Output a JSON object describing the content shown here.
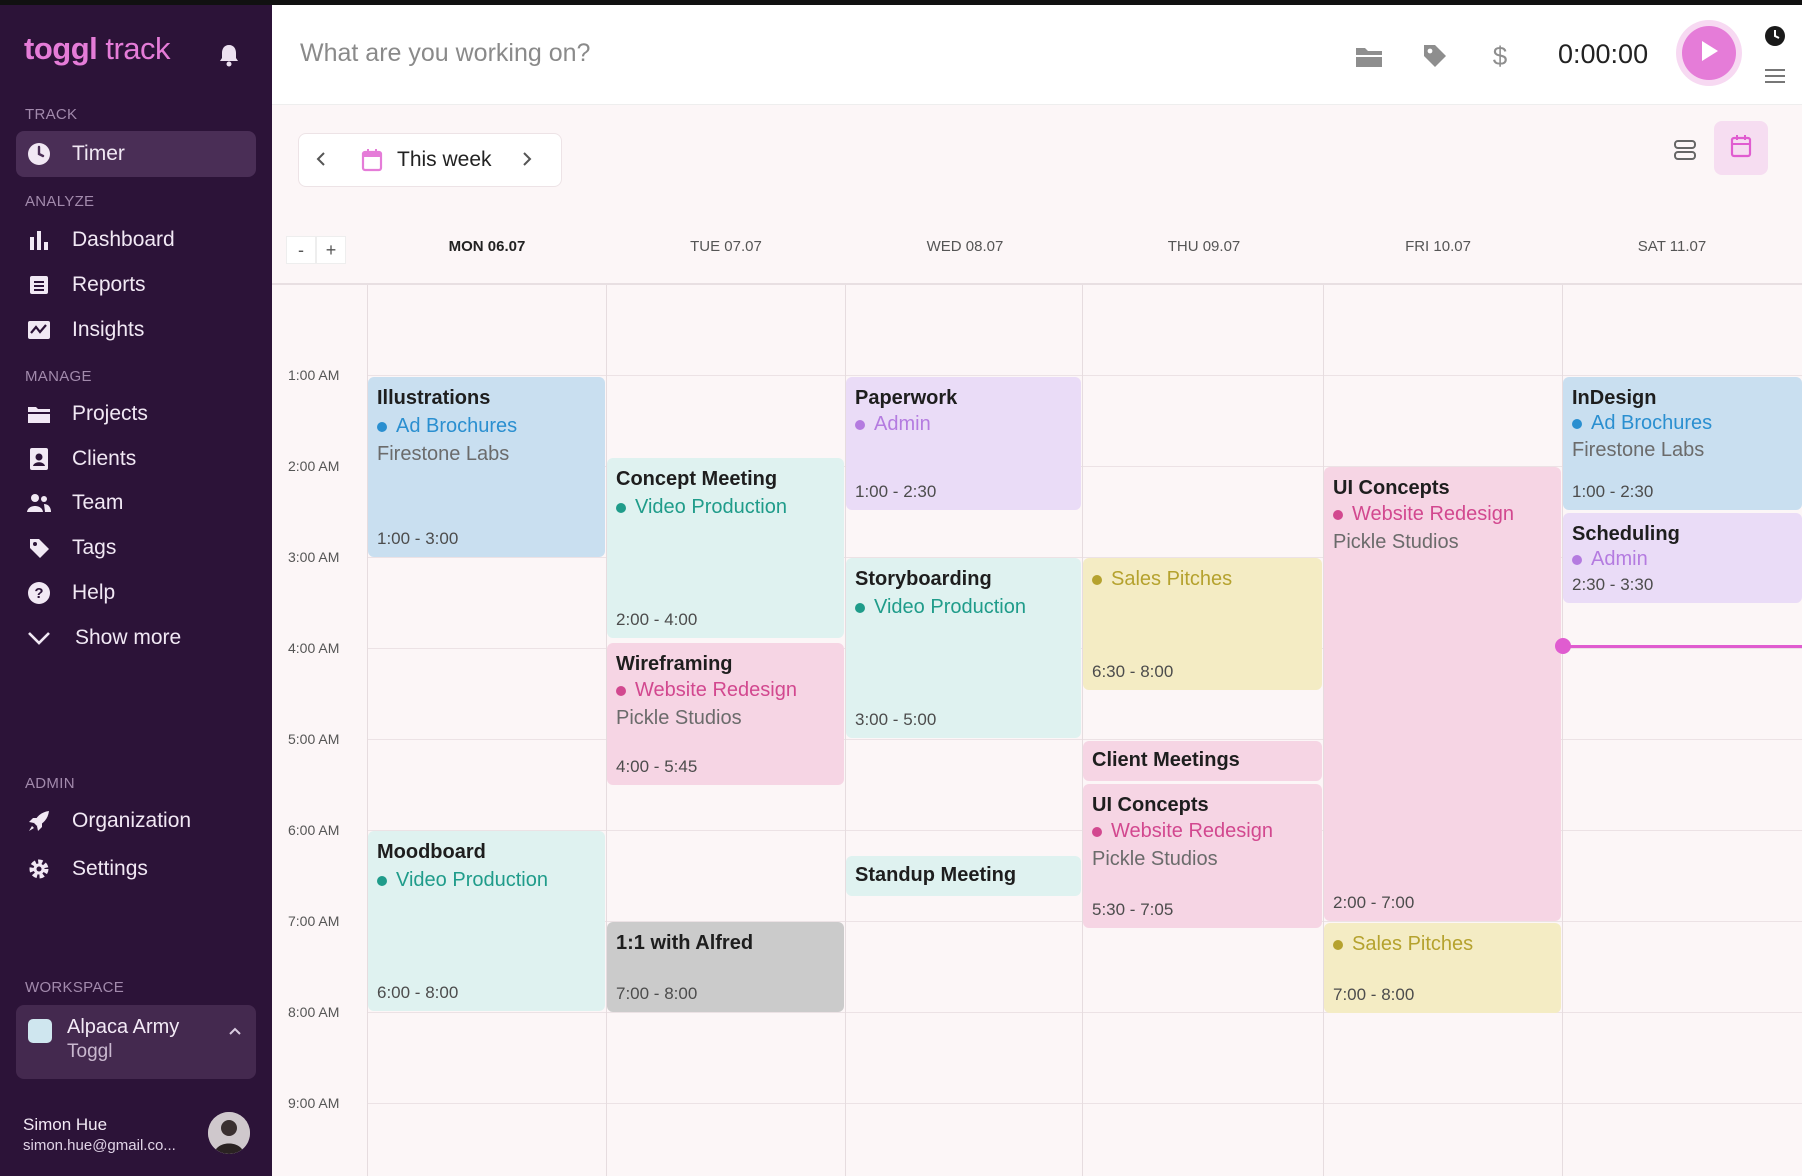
{
  "sidebar": {
    "logo_brand": "toggl",
    "logo_product": "track",
    "sections": {
      "track": "TRACK",
      "analyze": "ANALYZE",
      "manage": "MANAGE",
      "admin": "ADMIN",
      "workspace": "WORKSPACE"
    },
    "items": [
      {
        "label": "Timer",
        "icon": "clock-icon"
      },
      {
        "label": "Dashboard",
        "icon": "bar-chart-icon"
      },
      {
        "label": "Reports",
        "icon": "report-icon"
      },
      {
        "label": "Insights",
        "icon": "insights-icon"
      },
      {
        "label": "Projects",
        "icon": "folder-icon"
      },
      {
        "label": "Clients",
        "icon": "client-icon"
      },
      {
        "label": "Team",
        "icon": "team-icon"
      },
      {
        "label": "Tags",
        "icon": "tag-icon"
      },
      {
        "label": "Help",
        "icon": "help-icon"
      },
      {
        "label": "Show more",
        "icon": "chevron-down-icon"
      },
      {
        "label": "Organization",
        "icon": "rocket-icon"
      },
      {
        "label": "Settings",
        "icon": "gear-icon"
      }
    ],
    "workspace": {
      "name": "Alpaca Army",
      "sub": "Toggl"
    },
    "user": {
      "name": "Simon Hue",
      "email": "simon.hue@gmail.co..."
    }
  },
  "topbar": {
    "placeholder": "What are you working on?",
    "timer": "0:00:00"
  },
  "toolbar": {
    "week_label": "This week"
  },
  "calendar": {
    "zoom_out": "-",
    "zoom_in": "+",
    "days": [
      "MON 06.07",
      "TUE 07.07",
      "WED 08.07",
      "THU 09.07",
      "FRI 10.07",
      "SAT 11.07"
    ],
    "hours": [
      "1:00 AM",
      "2:00 AM",
      "3:00 AM",
      "4:00 AM",
      "5:00 AM",
      "6:00 AM",
      "7:00 AM",
      "8:00 AM",
      "9:00 AM"
    ],
    "events": [
      {
        "title": "Illustrations",
        "project": "Ad Brochures",
        "client": "Firestone Labs",
        "time": "1:00 - 3:00"
      },
      {
        "title": "Moodboard",
        "project": "Video Production",
        "client": "",
        "time": "6:00 - 8:00"
      },
      {
        "title": "Concept Meeting",
        "project": "Video Production",
        "client": "",
        "time": "2:00 - 4:00"
      },
      {
        "title": "Wireframing",
        "project": "Website Redesign",
        "client": "Pickle Studios",
        "time": "4:00 - 5:45"
      },
      {
        "title": "1:1 with Alfred",
        "project": "",
        "client": "",
        "time": "7:00 - 8:00"
      },
      {
        "title": "Paperwork",
        "project": "Admin",
        "client": "",
        "time": "1:00 - 2:30"
      },
      {
        "title": "Storyboarding",
        "project": "Video Production",
        "client": "",
        "time": "3:00 - 5:00"
      },
      {
        "title": "Standup Meeting",
        "project": "",
        "client": "",
        "time": ""
      },
      {
        "title": "",
        "project": "Sales Pitches",
        "client": "",
        "time": "6:30 - 8:00"
      },
      {
        "title": "Client Meetings",
        "project": "",
        "client": "",
        "time": ""
      },
      {
        "title": "UI Concepts",
        "project": "Website Redesign",
        "client": "Pickle Studios",
        "time": "5:30 - 7:05"
      },
      {
        "title": "UI Concepts",
        "project": "Website Redesign",
        "client": "Pickle Studios",
        "time": "2:00 - 7:00"
      },
      {
        "title": "",
        "project": "Sales Pitches",
        "client": "",
        "time": "7:00 - 8:00"
      },
      {
        "title": "InDesign",
        "project": "Ad Brochures",
        "client": "Firestone Labs",
        "time": "1:00 - 2:30"
      },
      {
        "title": "Scheduling",
        "project": "Admin",
        "client": "",
        "time": "2:30 - 3:30"
      }
    ]
  },
  "colors": {
    "accent": "#e57cd8",
    "sidebar_bg": "#2c1338",
    "blue_project": "#2a8fd0",
    "teal_project": "#1f9c8a",
    "pink_project": "#d2488f",
    "purple_project": "#b47be0",
    "yellow_project": "#b5a22e"
  }
}
